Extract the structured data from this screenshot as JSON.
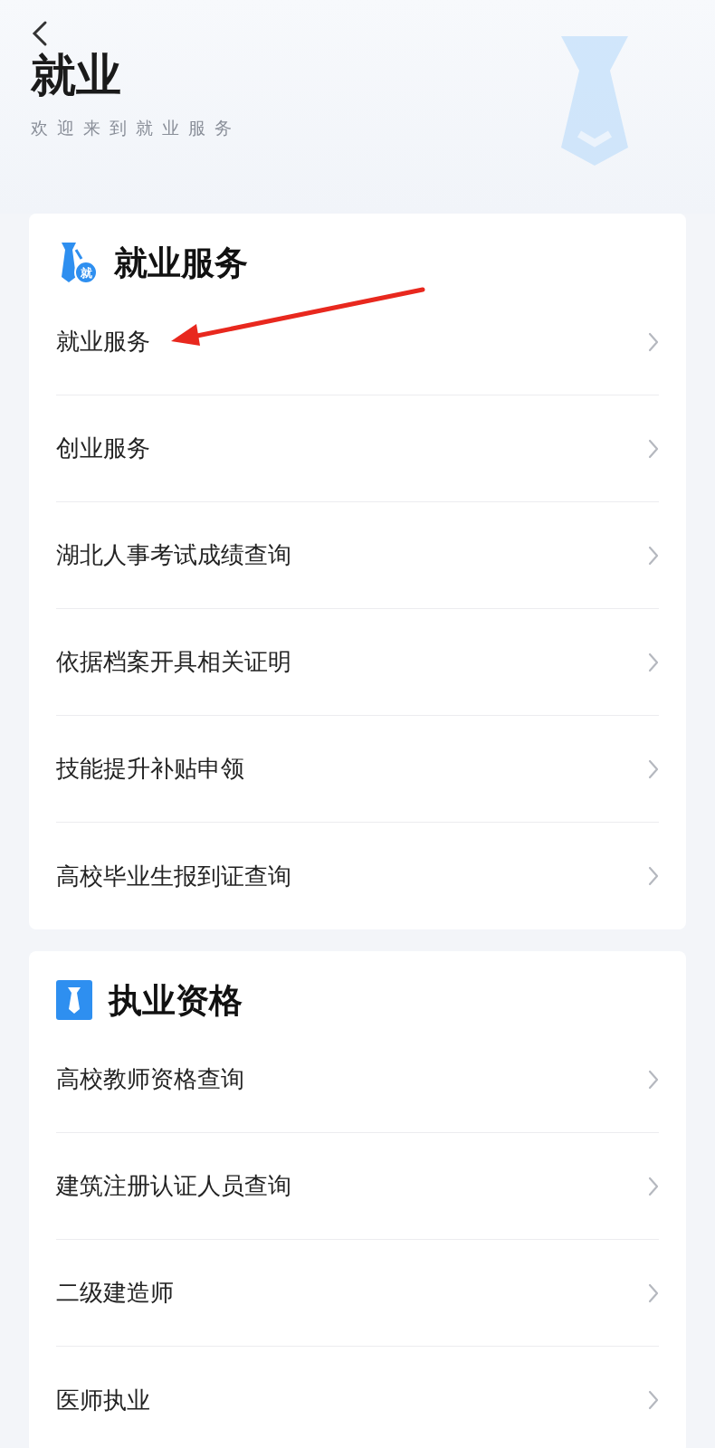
{
  "header": {
    "title": "就业",
    "subtitle": "欢迎来到就业服务"
  },
  "sections": [
    {
      "title": "就业服务",
      "kind": "tie-badge",
      "badge": "就",
      "items": [
        "就业服务",
        "创业服务",
        "湖北人事考试成绩查询",
        "依据档案开具相关证明",
        "技能提升补贴申领",
        "高校毕业生报到证查询"
      ]
    },
    {
      "title": "执业资格",
      "kind": "tie-square",
      "items": [
        "高校教师资格查询",
        "建筑注册认证人员查询",
        "二级建造师",
        "医师执业"
      ]
    }
  ]
}
